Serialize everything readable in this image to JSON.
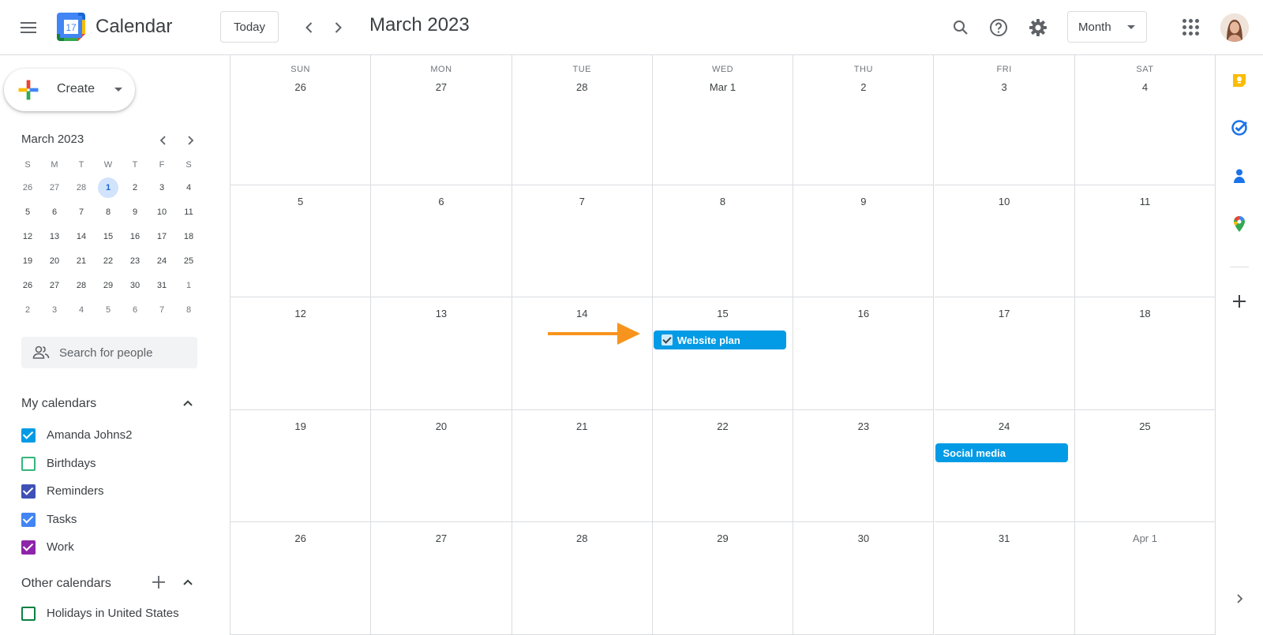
{
  "header": {
    "app_title": "Calendar",
    "logo_day": "17",
    "today_label": "Today",
    "current_period": "March 2023",
    "view_label": "Month",
    "colors": {
      "blue": "#4285f4",
      "green": "#34a853",
      "yellow": "#fbbc04",
      "red": "#ea4335"
    }
  },
  "sidebar": {
    "create_label": "Create",
    "mini_calendar": {
      "title": "March 2023",
      "weekday_letters": [
        "S",
        "M",
        "T",
        "W",
        "T",
        "F",
        "S"
      ],
      "weeks": [
        [
          "26",
          "27",
          "28",
          "1",
          "2",
          "3",
          "4"
        ],
        [
          "5",
          "6",
          "7",
          "8",
          "9",
          "10",
          "11"
        ],
        [
          "12",
          "13",
          "14",
          "15",
          "16",
          "17",
          "18"
        ],
        [
          "19",
          "20",
          "21",
          "22",
          "23",
          "24",
          "25"
        ],
        [
          "26",
          "27",
          "28",
          "29",
          "30",
          "31",
          "1"
        ],
        [
          "2",
          "3",
          "4",
          "5",
          "6",
          "7",
          "8"
        ]
      ],
      "today": "1"
    },
    "people_search_placeholder": "Search for people",
    "my_calendars_title": "My calendars",
    "my_calendars": [
      {
        "label": "Amanda Johns2",
        "color": "#039be5",
        "checked": true
      },
      {
        "label": "Birthdays",
        "color": "#33b679",
        "checked": false
      },
      {
        "label": "Reminders",
        "color": "#3f51b5",
        "checked": true
      },
      {
        "label": "Tasks",
        "color": "#4285f4",
        "checked": true
      },
      {
        "label": "Work",
        "color": "#8e24aa",
        "checked": true
      }
    ],
    "other_calendars_title": "Other calendars",
    "other_calendars": [
      {
        "label": "Holidays in United States",
        "color": "#0b8043",
        "checked": false
      }
    ]
  },
  "grid": {
    "weekdays": [
      "SUN",
      "MON",
      "TUE",
      "WED",
      "THU",
      "FRI",
      "SAT"
    ],
    "weeks": [
      [
        "26",
        "27",
        "28",
        "Mar 1",
        "2",
        "3",
        "4"
      ],
      [
        "5",
        "6",
        "7",
        "8",
        "9",
        "10",
        "11"
      ],
      [
        "12",
        "13",
        "14",
        "15",
        "16",
        "17",
        "18"
      ],
      [
        "19",
        "20",
        "21",
        "22",
        "23",
        "24",
        "25"
      ],
      [
        "26",
        "27",
        "28",
        "29",
        "30",
        "31",
        "Apr 1"
      ]
    ],
    "events": [
      {
        "title": "Website plan",
        "week": 2,
        "day": 3,
        "task": true,
        "color": "#039be5"
      },
      {
        "title": "Social media",
        "week": 3,
        "day": 5,
        "task": false,
        "color": "#039be5"
      }
    ],
    "annotation_arrow_color": "#f7941d"
  },
  "side_panel": {
    "icons": [
      "keep-icon",
      "tasks-icon",
      "contacts-icon",
      "maps-icon",
      "add-icon",
      "expand-icon"
    ]
  }
}
